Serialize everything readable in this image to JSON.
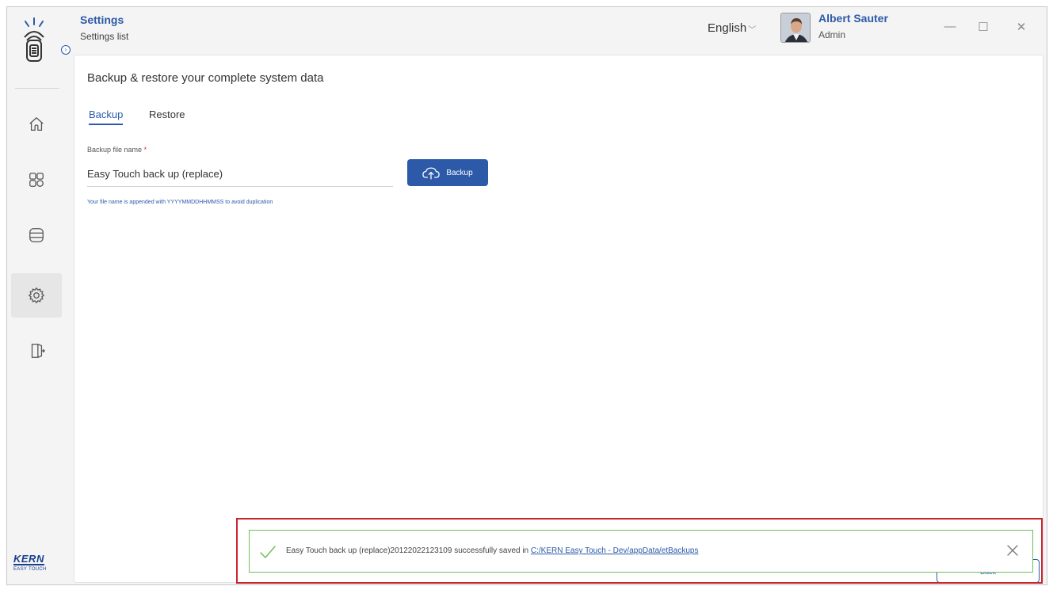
{
  "header": {
    "title": "Settings",
    "subtitle": "Settings list",
    "language": "English",
    "user_name": "Albert Sauter",
    "user_role": "Admin"
  },
  "window_controls": {
    "minimize": "—",
    "maximize": "☐",
    "close": "✕"
  },
  "sidebar": {
    "items": [
      {
        "name": "home",
        "icon": "home-icon",
        "active": false
      },
      {
        "name": "dashboard",
        "icon": "grid-icon",
        "active": false
      },
      {
        "name": "database",
        "icon": "database-icon",
        "active": false
      },
      {
        "name": "settings",
        "icon": "gear-icon",
        "active": true
      },
      {
        "name": "logout",
        "icon": "logout-icon",
        "active": false
      }
    ],
    "brand": "KERN",
    "brand_sub": "EASY TOUCH"
  },
  "main": {
    "section_title": "Backup & restore your complete system data",
    "tabs": [
      {
        "label": "Backup",
        "active": true
      },
      {
        "label": "Restore",
        "active": false
      }
    ],
    "field_label": "Backup file name",
    "field_required_mark": "*",
    "field_value": "Easy Touch back up (replace)",
    "backup_button": "Backup",
    "hint": "Your file name is appended with YYYYMMDDHHMMSS to avoid duplication",
    "back_button": "Back"
  },
  "toast": {
    "message": "Easy Touch back up (replace)20122022123109 successfully saved in ",
    "link": "C:/KERN Easy Touch - Dev/appData/etBackups"
  },
  "colors": {
    "accent": "#2c5aa8",
    "success": "#6fbf5a",
    "highlight": "#c7262e"
  }
}
